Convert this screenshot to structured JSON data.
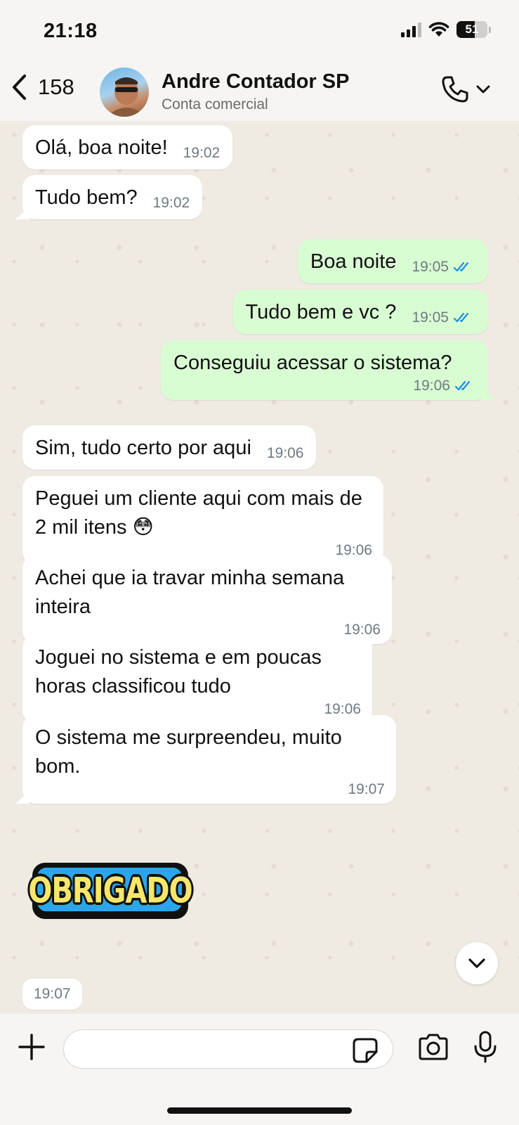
{
  "status_bar": {
    "time": "21:18",
    "battery": "51"
  },
  "header": {
    "back_count": "158",
    "contact_name": "Andre Contador SP",
    "contact_subtitle": "Conta comercial"
  },
  "messages": [
    {
      "direction": "in",
      "text": "Olá, boa noite!",
      "time": "19:02"
    },
    {
      "direction": "in",
      "text": "Tudo bem?",
      "time": "19:02"
    },
    {
      "direction": "out",
      "text": "Boa noite",
      "time": "19:05",
      "status": "read"
    },
    {
      "direction": "out",
      "text": "Tudo bem e vc ?",
      "time": "19:05",
      "status": "read"
    },
    {
      "direction": "out",
      "text": "Conseguiu acessar o sistema?",
      "time": "19:06",
      "status": "read"
    },
    {
      "direction": "in",
      "text": "Sim, tudo certo por aqui",
      "time": "19:06"
    },
    {
      "direction": "in",
      "text": "Peguei um cliente aqui com mais de 2 mil itens 😳",
      "time": "19:06"
    },
    {
      "direction": "in",
      "text": "Achei que ia travar minha semana inteira",
      "time": "19:06"
    },
    {
      "direction": "in",
      "text": "Joguei no sistema e em poucas horas classificou tudo",
      "time": "19:06"
    },
    {
      "direction": "in",
      "text": "O sistema me surpreendeu, muito bom.",
      "time": "19:07"
    }
  ],
  "sticker": {
    "text": "OBRIGADO",
    "time": "19:07"
  },
  "composer": {
    "placeholder": ""
  },
  "colors": {
    "outgoing_bubble": "#d9fdd3",
    "incoming_bubble": "#ffffff",
    "read_ticks": "#1d8fe0"
  },
  "icons": [
    "back-chevron-icon",
    "phone-icon",
    "chevron-down-icon",
    "plus-icon",
    "sticker-icon",
    "camera-icon",
    "microphone-icon"
  ]
}
